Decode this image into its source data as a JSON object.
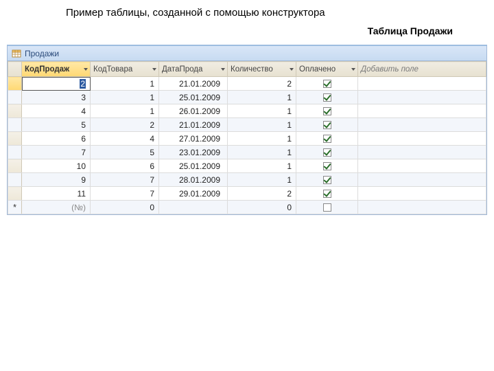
{
  "page": {
    "title": "Пример таблицы, созданной с помощью конструктора",
    "subtitle": "Таблица Продажи"
  },
  "tab": {
    "label": "Продажи"
  },
  "columns": {
    "c0": "КодПродаж",
    "c1": "КодТовара",
    "c2": "ДатаПрода",
    "c3": "Количество",
    "c4": "Оплачено",
    "add": "Добавить поле"
  },
  "rows": [
    {
      "id": "2",
      "tovar": "1",
      "date": "21.01.2009",
      "qty": "2",
      "paid": true
    },
    {
      "id": "3",
      "tovar": "1",
      "date": "25.01.2009",
      "qty": "1",
      "paid": true
    },
    {
      "id": "4",
      "tovar": "1",
      "date": "26.01.2009",
      "qty": "1",
      "paid": true
    },
    {
      "id": "5",
      "tovar": "2",
      "date": "21.01.2009",
      "qty": "1",
      "paid": true
    },
    {
      "id": "6",
      "tovar": "4",
      "date": "27.01.2009",
      "qty": "1",
      "paid": true
    },
    {
      "id": "7",
      "tovar": "5",
      "date": "23.01.2009",
      "qty": "1",
      "paid": true
    },
    {
      "id": "10",
      "tovar": "6",
      "date": "25.01.2009",
      "qty": "1",
      "paid": true
    },
    {
      "id": "9",
      "tovar": "7",
      "date": "28.01.2009",
      "qty": "1",
      "paid": true
    },
    {
      "id": "11",
      "tovar": "7",
      "date": "29.01.2009",
      "qty": "2",
      "paid": true
    }
  ],
  "newrow": {
    "marker": "*",
    "id_hint": "(№)",
    "tovar": "0",
    "date": "",
    "qty": "0",
    "paid": false
  },
  "glyphs": {
    "dropdown": "▾"
  }
}
